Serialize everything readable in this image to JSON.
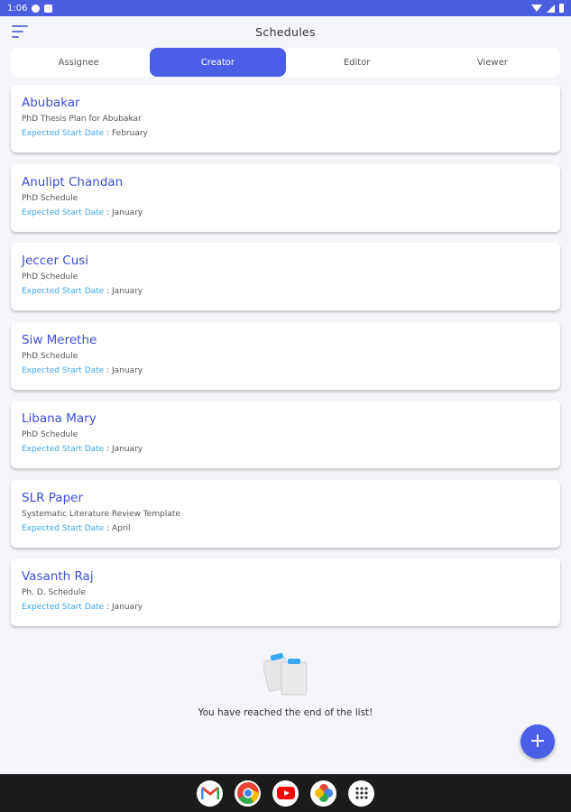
{
  "status_bar": {
    "time": "1:06"
  },
  "header": {
    "title": "Schedules"
  },
  "tabs": [
    {
      "label": "Assignee",
      "active": false
    },
    {
      "label": "Creator",
      "active": true
    },
    {
      "label": "Editor",
      "active": false
    },
    {
      "label": "Viewer",
      "active": false
    }
  ],
  "schedules": [
    {
      "name": "Abubakar",
      "subtitle": "PhD Thesis Plan for Abubakar",
      "date_label": "Expected Start Date",
      "date_value": "February"
    },
    {
      "name": "Anulipt Chandan",
      "subtitle": "PhD Schedule",
      "date_label": "Expected Start Date",
      "date_value": "January"
    },
    {
      "name": "Jeccer Cusi",
      "subtitle": "PhD Schedule",
      "date_label": "Expected Start Date",
      "date_value": "January"
    },
    {
      "name": "Siw Merethe",
      "subtitle": "PhD Schedule",
      "date_label": "Expected Start Date",
      "date_value": "January"
    },
    {
      "name": "Libana Mary",
      "subtitle": "PhD Schedule",
      "date_label": "Expected Start Date",
      "date_value": "January"
    },
    {
      "name": "SLR Paper",
      "subtitle": "Systematic Literature Review Template",
      "date_label": "Expected Start Date",
      "date_value": "April"
    },
    {
      "name": "Vasanth Raj",
      "subtitle": "Ph. D. Schedule",
      "date_label": "Expected Start Date",
      "date_value": "January"
    }
  ],
  "end_of_list": {
    "message": "You have reached the end of the list!"
  },
  "fab": {
    "label": "+"
  },
  "taskbar": {
    "apps": [
      "gmail-icon",
      "chrome-icon",
      "youtube-icon",
      "photos-icon",
      "app-drawer-icon"
    ]
  },
  "colors": {
    "primary": "#4a5fe6",
    "title": "#3b4fd8",
    "date_label": "#3aa6f0"
  }
}
